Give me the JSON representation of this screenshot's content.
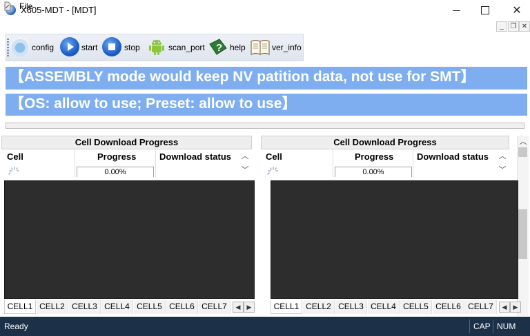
{
  "window": {
    "title": "X605-MDT - [MDT]",
    "min_glyph": "—",
    "close_glyph": "✕"
  },
  "menu": {
    "file": "File",
    "mdi_min": "_",
    "mdi_restore": "❐",
    "mdi_close": "✕"
  },
  "toolbar": {
    "items": [
      {
        "label": "config",
        "icon": "config-disc-icon"
      },
      {
        "label": "start",
        "icon": "play-icon"
      },
      {
        "label": "stop",
        "icon": "stop-icon"
      },
      {
        "label": "scan_port",
        "icon": "android-icon"
      },
      {
        "label": "help",
        "icon": "help-icon"
      },
      {
        "label": "ver_info",
        "icon": "book-icon"
      }
    ]
  },
  "banners": {
    "line1": "【ASSEMBLY mode would keep NV patition data,  not use for SMT】",
    "line2": "【OS: allow to use; Preset: allow to use】"
  },
  "panels": [
    {
      "title": "Cell Download Progress",
      "columns": [
        "Cell",
        "Progress",
        "Download status"
      ],
      "progress_value": "0.00%",
      "tabs": [
        "CELL1",
        "CELL2",
        "CELL3",
        "CELL4",
        "CELL5",
        "CELL6",
        "CELL7"
      ],
      "active_tab": "CELL1"
    },
    {
      "title": "Cell Download Progress",
      "columns": [
        "Cell",
        "Progress",
        "Download status"
      ],
      "progress_value": "0.00%",
      "tabs": [
        "CELL1",
        "CELL2",
        "CELL3",
        "CELL4",
        "CELL5",
        "CELL6",
        "CELL7"
      ],
      "active_tab": "CELL1"
    }
  ],
  "status": {
    "ready": "Ready",
    "cap": "CAP",
    "num": "NUM"
  },
  "colors": {
    "banner": "#7eaef0",
    "statusbar": "#1c3048",
    "console": "#2d2d2d"
  }
}
